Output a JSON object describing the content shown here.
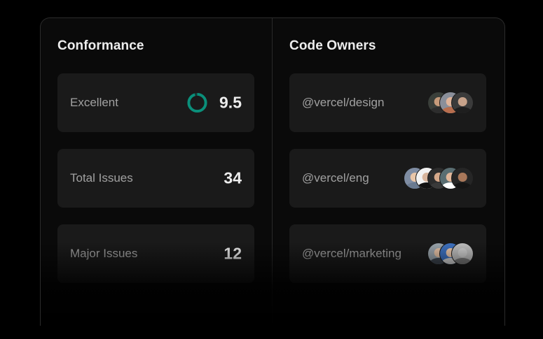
{
  "conformance": {
    "title": "Conformance",
    "cards": [
      {
        "label": "Excellent",
        "value": "9.5",
        "score_fraction": 0.95,
        "ring_color": "#0a8f7a"
      },
      {
        "label": "Total Issues",
        "value": "34"
      },
      {
        "label": "Major Issues",
        "value": "12"
      }
    ]
  },
  "code_owners": {
    "title": "Code Owners",
    "teams": [
      {
        "label": "@vercel/design",
        "avatars": [
          {
            "bg": "#3a3f3a",
            "skin": "#c69a7a",
            "shirt": "#2d2d2d"
          },
          {
            "bg": "#8a8f9a",
            "skin": "#e0b49a",
            "shirt": "#b86e4e"
          },
          {
            "bg": "#3b3b3b",
            "skin": "#c8a38b",
            "shirt": "#1e1e1e"
          }
        ]
      },
      {
        "label": "@vercel/eng",
        "avatars": [
          {
            "bg": "#7f8da3",
            "skin": "#e9c6a8",
            "shirt": "#6a7a90"
          },
          {
            "bg": "#f2f2f2",
            "skin": "#d8b59d",
            "shirt": "#111111"
          },
          {
            "bg": "#2d2d2d",
            "skin": "#d6a98a",
            "shirt": "#3a3a3a"
          },
          {
            "bg": "#5a6e72",
            "skin": "#e2b79a",
            "shirt": "#ffffff"
          },
          {
            "bg": "#262626",
            "skin": "#a9785a",
            "shirt": "#151515"
          }
        ]
      },
      {
        "label": "@vercel/marketing",
        "avatars": [
          {
            "bg": "#9aa5ad",
            "skin": "#e7c3a6",
            "shirt": "#3e4650"
          },
          {
            "bg": "#3f73c2",
            "skin": "#edc9ad",
            "shirt": "#d8d8d8"
          },
          {
            "bg": "#bfbfbf",
            "skin": "#cfcfcf",
            "shirt": "#7a7a7a"
          }
        ]
      }
    ]
  }
}
